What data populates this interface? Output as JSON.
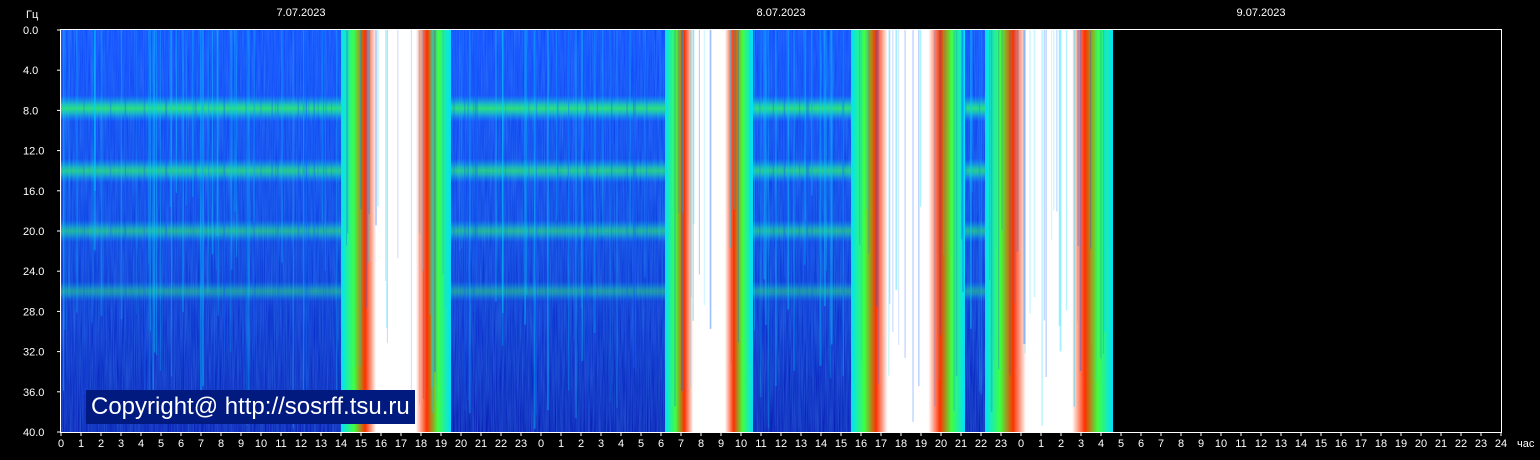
{
  "chart_data": {
    "type": "heatmap",
    "title": "",
    "ylabel": "Гц",
    "xlabel": "час",
    "ylim": [
      0,
      40
    ],
    "y_ticks": [
      "0.0",
      "4.0",
      "8.0",
      "12.0",
      "16.0",
      "20.0",
      "24.0",
      "28.0",
      "32.0",
      "36.0",
      "40.0"
    ],
    "dates": [
      "7.07.2023",
      "8.07.2023",
      "9.07.2023"
    ],
    "x_ticks": [
      "0",
      "1",
      "2",
      "3",
      "4",
      "5",
      "6",
      "7",
      "8",
      "9",
      "10",
      "11",
      "12",
      "13",
      "14",
      "15",
      "16",
      "17",
      "18",
      "19",
      "20",
      "21",
      "22",
      "23",
      "0",
      "1",
      "2",
      "3",
      "4",
      "5",
      "6",
      "7",
      "8",
      "9",
      "10",
      "11",
      "12",
      "13",
      "14",
      "15",
      "16",
      "17",
      "18",
      "19",
      "20",
      "21",
      "22",
      "23",
      "0",
      "1",
      "2",
      "3",
      "4",
      "5",
      "6",
      "7",
      "8",
      "9",
      "10",
      "11",
      "12",
      "13",
      "14",
      "15",
      "16",
      "17",
      "18",
      "19",
      "20",
      "21",
      "22",
      "23",
      "24"
    ],
    "data_end_hour": 52.6,
    "resonance_bands_hz": [
      7.8,
      14.0,
      20.0,
      26.0
    ],
    "intense_periods_hours": [
      [
        14,
        19.5
      ],
      [
        30.2,
        34.6
      ],
      [
        39.5,
        45.2
      ],
      [
        46.2,
        52.6
      ]
    ],
    "colors": [
      "#0000c0",
      "#0050ff",
      "#00ffff",
      "#00ff00",
      "#ff0000",
      "#ffffff"
    ]
  },
  "copyright": "Copyright@ http://sosrff.tsu.ru"
}
